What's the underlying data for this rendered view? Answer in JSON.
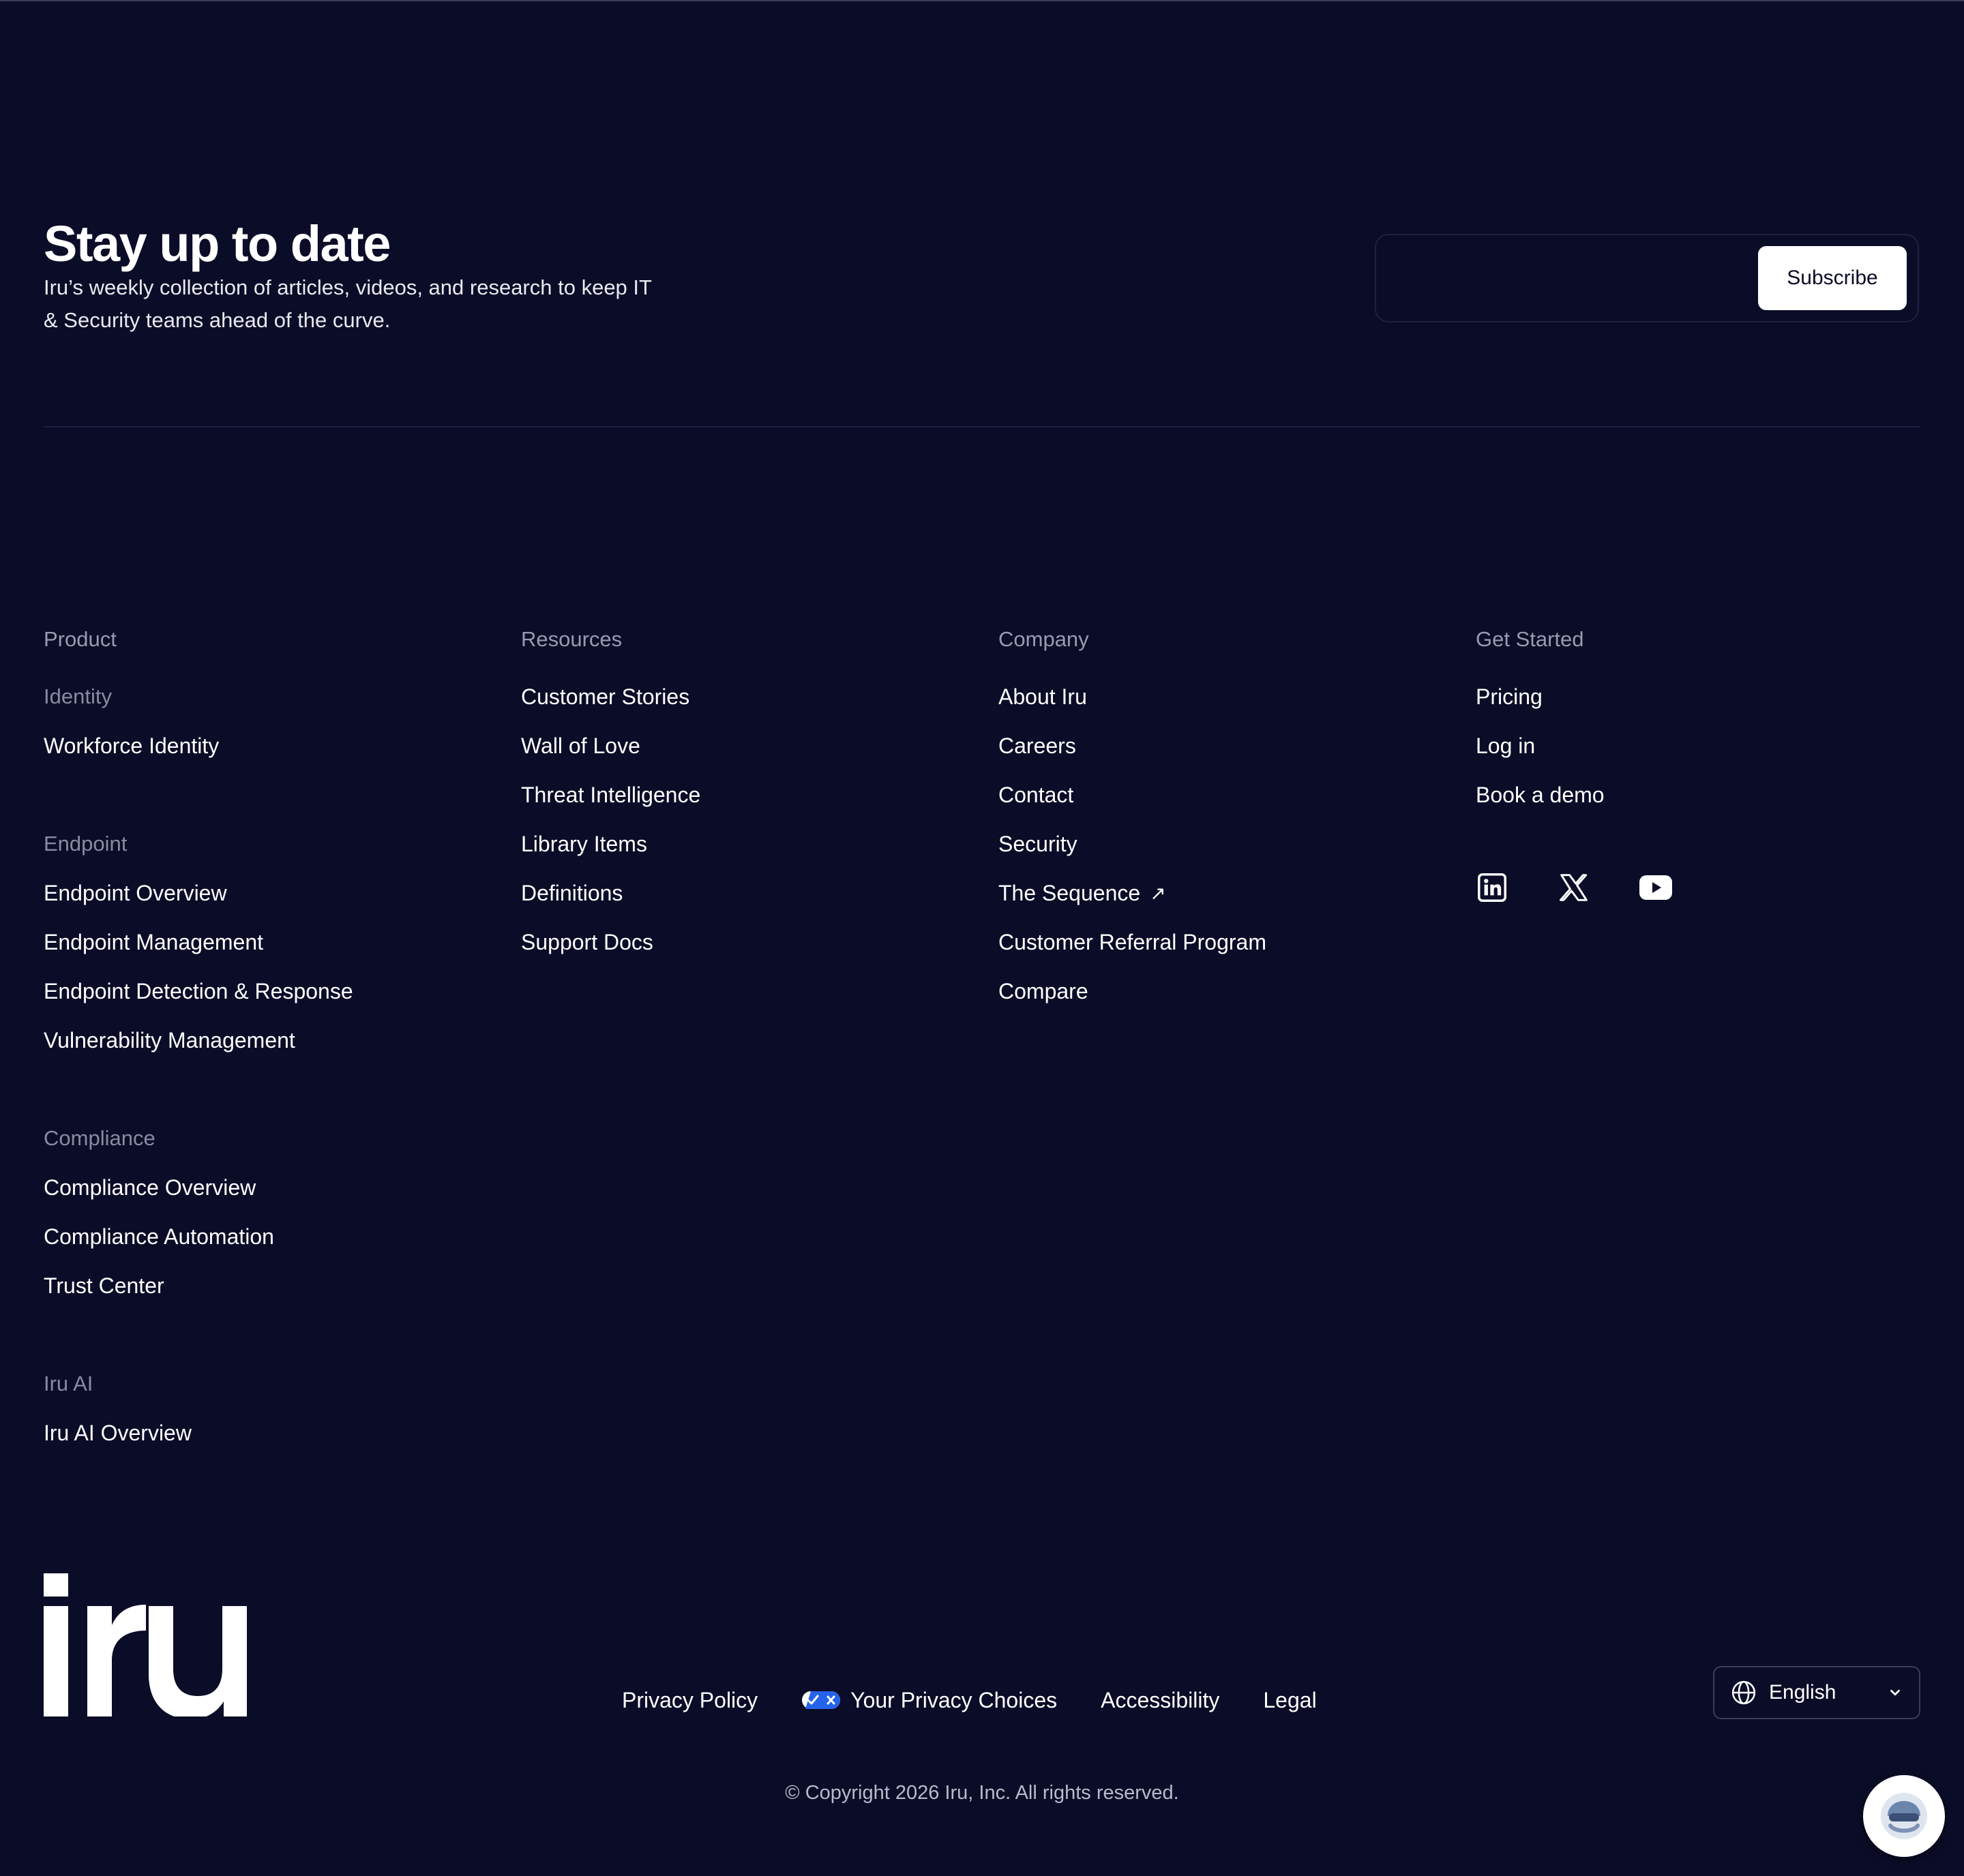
{
  "newsletter": {
    "title": "Stay up to date",
    "description": "Iru’s weekly collection of articles, videos, and research to keep IT & Security teams ahead of the curve.",
    "email_placeholder": "",
    "subscribe_label": "Subscribe"
  },
  "columns": {
    "product": {
      "heading": "Product",
      "groups": [
        {
          "title": "Identity",
          "links": [
            "Workforce Identity"
          ]
        },
        {
          "title": "Endpoint",
          "links": [
            "Endpoint Overview",
            "Endpoint Management",
            "Endpoint Detection & Response",
            "Vulnerability Management"
          ]
        },
        {
          "title": "Compliance",
          "links": [
            "Compliance Overview",
            "Compliance Automation",
            "Trust Center"
          ]
        },
        {
          "title": "Iru AI",
          "links": [
            "Iru AI Overview"
          ]
        }
      ]
    },
    "resources": {
      "heading": "Resources",
      "links": [
        "Customer Stories",
        "Wall of Love",
        "Threat Intelligence",
        "Library Items",
        "Definitions",
        "Support Docs"
      ]
    },
    "company": {
      "heading": "Company",
      "links": [
        "About Iru",
        "Careers",
        "Contact",
        "Security",
        "The Sequence",
        "Customer Referral Program",
        "Compare"
      ]
    },
    "get_started": {
      "heading": "Get Started",
      "links": [
        "Pricing",
        "Log in",
        "Book a demo"
      ]
    }
  },
  "social": [
    "linkedin-icon",
    "x-icon",
    "youtube-icon"
  ],
  "logo_text": "iru",
  "legal": {
    "privacy_policy": "Privacy Policy",
    "privacy_choices": "Your Privacy Choices",
    "accessibility": "Accessibility",
    "legal": "Legal"
  },
  "copyright": "© Copyright 2026 Iru, Inc. All rights reserved.",
  "language": {
    "selected": "English"
  },
  "colors": {
    "background": "#0b0c27",
    "muted_text": "#9a9bb0",
    "privacy_toggle": "#2563eb"
  }
}
